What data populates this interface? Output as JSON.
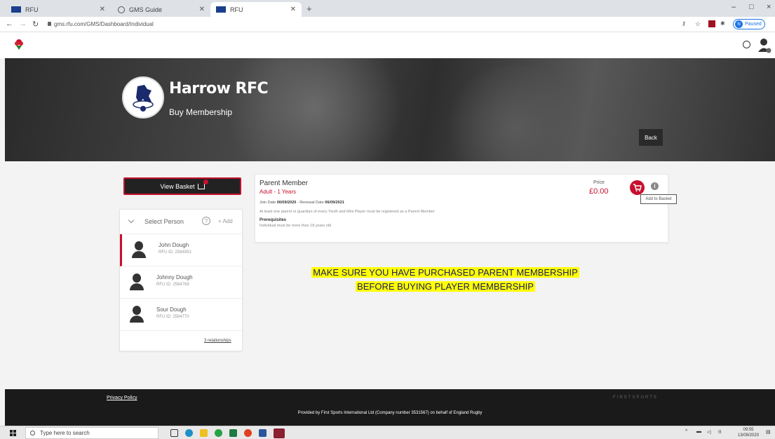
{
  "browser": {
    "tabs": [
      {
        "title": "RFU",
        "active": false
      },
      {
        "title": "GMS Guide",
        "active": false
      },
      {
        "title": "RFU",
        "active": true
      }
    ],
    "new_tab": "+",
    "url": "gms.rfu.com/GMS/Dashboard/Individual",
    "profile_status": "Paused",
    "profile_initial": "N",
    "window_controls": [
      "–",
      "□",
      "×"
    ]
  },
  "hero": {
    "club_name": "Harrow RFC",
    "subtitle": "Buy Membership",
    "back_label": "Back"
  },
  "basket": {
    "label": "View Basket"
  },
  "person_panel": {
    "select_label": "Select Person",
    "help": "?",
    "add_label": "+ Add",
    "people": [
      {
        "name": "John Dough",
        "rfu_id": "RFU ID: 2584953",
        "selected": true
      },
      {
        "name": "Johnny Dough",
        "rfu_id": "RFU ID: 2584769",
        "selected": false
      },
      {
        "name": "Sour Dough",
        "rfu_id": "RFU ID: 2584770",
        "selected": false
      }
    ],
    "relationships_link": "3 relationships"
  },
  "membership": {
    "title": "Parent Member",
    "subtitle": "Adult - 1 Years",
    "join_label": "Join Date",
    "join_date": "06/09/2020",
    "renewal_label": "- Renewal Date",
    "renewal_date": "06/09/2021",
    "description": "At least one parent or guardian of every Youth and Mini Player must be registered as a Parent Member",
    "prereq_title": "Prerequisites",
    "prereq_text": "Individual must be more than 18 years old",
    "price_label": "Price",
    "price": "£0.00",
    "tooltip": "Add to Basket"
  },
  "notice": {
    "line1": "MAKE SURE YOU HAVE PURCHASED PARENT MEMBERSHIP",
    "line2": "BEFORE BUYING PLAYER MEMBERSHIP"
  },
  "footer": {
    "privacy": "Privacy Policy",
    "provided_by": "Provided by First Sports International Ltd (Company number 3531567) on behalf of England Rugby",
    "brand": "FIRSTSPORTS"
  },
  "taskbar": {
    "search_placeholder": "Type here to search",
    "time": "09:55",
    "date": "13/09/2020"
  },
  "colors": {
    "accent": "#c8102e",
    "notice_highlight": "#ffff00",
    "dark": "#1a1a1a"
  }
}
